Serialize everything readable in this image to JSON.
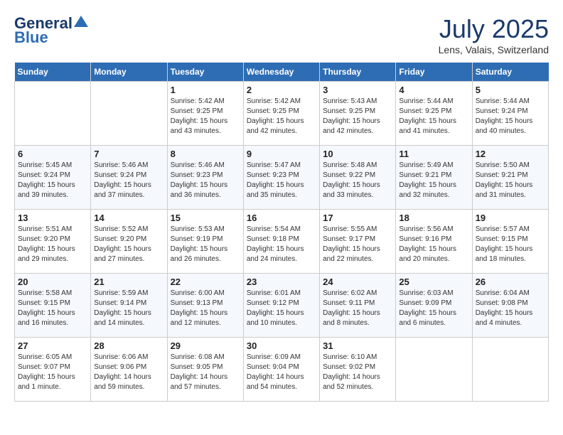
{
  "logo": {
    "part1": "General",
    "part2": "Blue"
  },
  "title": "July 2025",
  "subtitle": "Lens, Valais, Switzerland",
  "days_header": [
    "Sunday",
    "Monday",
    "Tuesday",
    "Wednesday",
    "Thursday",
    "Friday",
    "Saturday"
  ],
  "weeks": [
    [
      {
        "day": "",
        "info": ""
      },
      {
        "day": "",
        "info": ""
      },
      {
        "day": "1",
        "info": "Sunrise: 5:42 AM\nSunset: 9:25 PM\nDaylight: 15 hours\nand 43 minutes."
      },
      {
        "day": "2",
        "info": "Sunrise: 5:42 AM\nSunset: 9:25 PM\nDaylight: 15 hours\nand 42 minutes."
      },
      {
        "day": "3",
        "info": "Sunrise: 5:43 AM\nSunset: 9:25 PM\nDaylight: 15 hours\nand 42 minutes."
      },
      {
        "day": "4",
        "info": "Sunrise: 5:44 AM\nSunset: 9:25 PM\nDaylight: 15 hours\nand 41 minutes."
      },
      {
        "day": "5",
        "info": "Sunrise: 5:44 AM\nSunset: 9:24 PM\nDaylight: 15 hours\nand 40 minutes."
      }
    ],
    [
      {
        "day": "6",
        "info": "Sunrise: 5:45 AM\nSunset: 9:24 PM\nDaylight: 15 hours\nand 39 minutes."
      },
      {
        "day": "7",
        "info": "Sunrise: 5:46 AM\nSunset: 9:24 PM\nDaylight: 15 hours\nand 37 minutes."
      },
      {
        "day": "8",
        "info": "Sunrise: 5:46 AM\nSunset: 9:23 PM\nDaylight: 15 hours\nand 36 minutes."
      },
      {
        "day": "9",
        "info": "Sunrise: 5:47 AM\nSunset: 9:23 PM\nDaylight: 15 hours\nand 35 minutes."
      },
      {
        "day": "10",
        "info": "Sunrise: 5:48 AM\nSunset: 9:22 PM\nDaylight: 15 hours\nand 33 minutes."
      },
      {
        "day": "11",
        "info": "Sunrise: 5:49 AM\nSunset: 9:21 PM\nDaylight: 15 hours\nand 32 minutes."
      },
      {
        "day": "12",
        "info": "Sunrise: 5:50 AM\nSunset: 9:21 PM\nDaylight: 15 hours\nand 31 minutes."
      }
    ],
    [
      {
        "day": "13",
        "info": "Sunrise: 5:51 AM\nSunset: 9:20 PM\nDaylight: 15 hours\nand 29 minutes."
      },
      {
        "day": "14",
        "info": "Sunrise: 5:52 AM\nSunset: 9:20 PM\nDaylight: 15 hours\nand 27 minutes."
      },
      {
        "day": "15",
        "info": "Sunrise: 5:53 AM\nSunset: 9:19 PM\nDaylight: 15 hours\nand 26 minutes."
      },
      {
        "day": "16",
        "info": "Sunrise: 5:54 AM\nSunset: 9:18 PM\nDaylight: 15 hours\nand 24 minutes."
      },
      {
        "day": "17",
        "info": "Sunrise: 5:55 AM\nSunset: 9:17 PM\nDaylight: 15 hours\nand 22 minutes."
      },
      {
        "day": "18",
        "info": "Sunrise: 5:56 AM\nSunset: 9:16 PM\nDaylight: 15 hours\nand 20 minutes."
      },
      {
        "day": "19",
        "info": "Sunrise: 5:57 AM\nSunset: 9:15 PM\nDaylight: 15 hours\nand 18 minutes."
      }
    ],
    [
      {
        "day": "20",
        "info": "Sunrise: 5:58 AM\nSunset: 9:15 PM\nDaylight: 15 hours\nand 16 minutes."
      },
      {
        "day": "21",
        "info": "Sunrise: 5:59 AM\nSunset: 9:14 PM\nDaylight: 15 hours\nand 14 minutes."
      },
      {
        "day": "22",
        "info": "Sunrise: 6:00 AM\nSunset: 9:13 PM\nDaylight: 15 hours\nand 12 minutes."
      },
      {
        "day": "23",
        "info": "Sunrise: 6:01 AM\nSunset: 9:12 PM\nDaylight: 15 hours\nand 10 minutes."
      },
      {
        "day": "24",
        "info": "Sunrise: 6:02 AM\nSunset: 9:11 PM\nDaylight: 15 hours\nand 8 minutes."
      },
      {
        "day": "25",
        "info": "Sunrise: 6:03 AM\nSunset: 9:09 PM\nDaylight: 15 hours\nand 6 minutes."
      },
      {
        "day": "26",
        "info": "Sunrise: 6:04 AM\nSunset: 9:08 PM\nDaylight: 15 hours\nand 4 minutes."
      }
    ],
    [
      {
        "day": "27",
        "info": "Sunrise: 6:05 AM\nSunset: 9:07 PM\nDaylight: 15 hours\nand 1 minute."
      },
      {
        "day": "28",
        "info": "Sunrise: 6:06 AM\nSunset: 9:06 PM\nDaylight: 14 hours\nand 59 minutes."
      },
      {
        "day": "29",
        "info": "Sunrise: 6:08 AM\nSunset: 9:05 PM\nDaylight: 14 hours\nand 57 minutes."
      },
      {
        "day": "30",
        "info": "Sunrise: 6:09 AM\nSunset: 9:04 PM\nDaylight: 14 hours\nand 54 minutes."
      },
      {
        "day": "31",
        "info": "Sunrise: 6:10 AM\nSunset: 9:02 PM\nDaylight: 14 hours\nand 52 minutes."
      },
      {
        "day": "",
        "info": ""
      },
      {
        "day": "",
        "info": ""
      }
    ]
  ]
}
